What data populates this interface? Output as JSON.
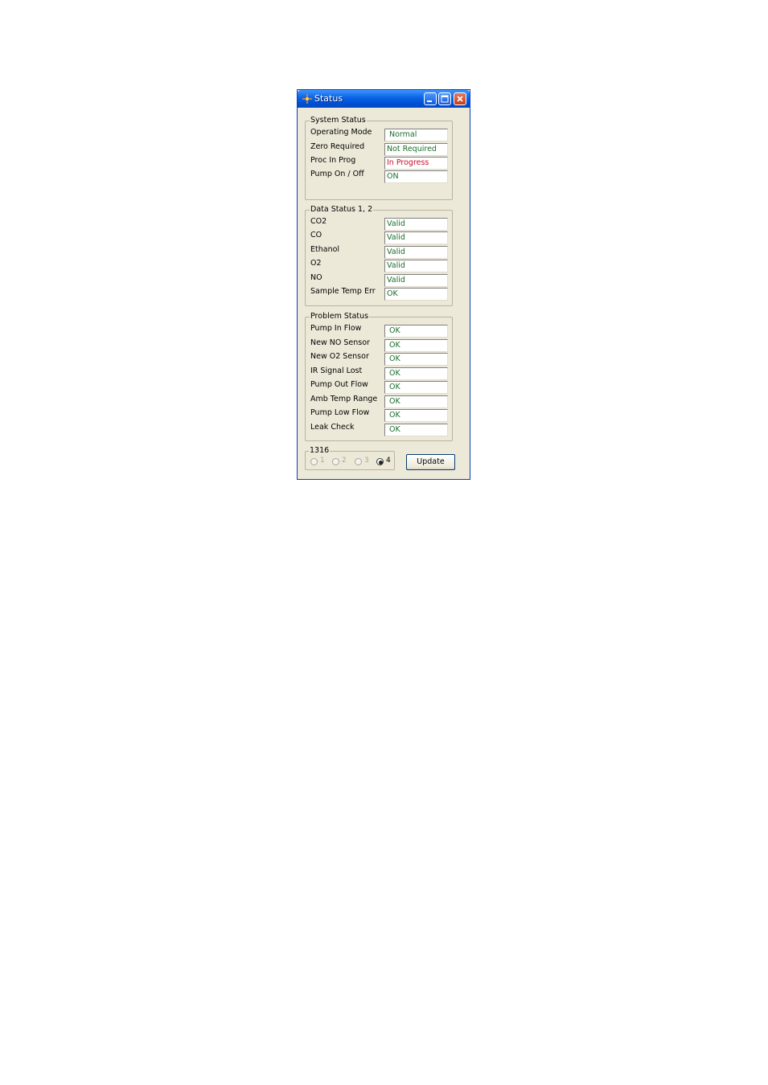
{
  "window": {
    "title": "Status"
  },
  "system_status": {
    "title": "System Status",
    "rows": [
      {
        "label": "Operating Mode",
        "value": "Normal"
      },
      {
        "label": "Zero Required",
        "value": "Not Required"
      },
      {
        "label": "Proc In Prog",
        "value": "In Progress"
      },
      {
        "label": "Pump On / Off",
        "value": "ON"
      }
    ]
  },
  "data_status": {
    "title": "Data Status 1, 2",
    "rows": [
      {
        "label": "CO2",
        "value": "Valid"
      },
      {
        "label": "CO",
        "value": "Valid"
      },
      {
        "label": "Ethanol",
        "value": "Valid"
      },
      {
        "label": "O2",
        "value": "Valid"
      },
      {
        "label": "NO",
        "value": "Valid"
      },
      {
        "label": "Sample Temp Err",
        "value": "OK"
      }
    ]
  },
  "problem_status": {
    "title": "Problem Status",
    "rows": [
      {
        "label": "Pump In Flow",
        "value": "OK"
      },
      {
        "label": "New NO Sensor",
        "value": "OK"
      },
      {
        "label": "New O2 Sensor",
        "value": "OK"
      },
      {
        "label": "IR Signal Lost",
        "value": "OK"
      },
      {
        "label": "Pump Out Flow",
        "value": "OK"
      },
      {
        "label": "Amb Temp Range",
        "value": "OK"
      },
      {
        "label": "Pump Low Flow",
        "value": "OK"
      },
      {
        "label": "Leak Check",
        "value": "OK"
      }
    ]
  },
  "selector": {
    "title": "1316",
    "options": [
      "1",
      "2",
      "3",
      "4"
    ],
    "selected": "4"
  },
  "update_button": {
    "label": "Update"
  },
  "colors": {
    "ok_text": "#1a6e2a",
    "alert_text": "#c8102e",
    "titlebar": "#0053d6",
    "window_bg": "#ece9d8"
  }
}
